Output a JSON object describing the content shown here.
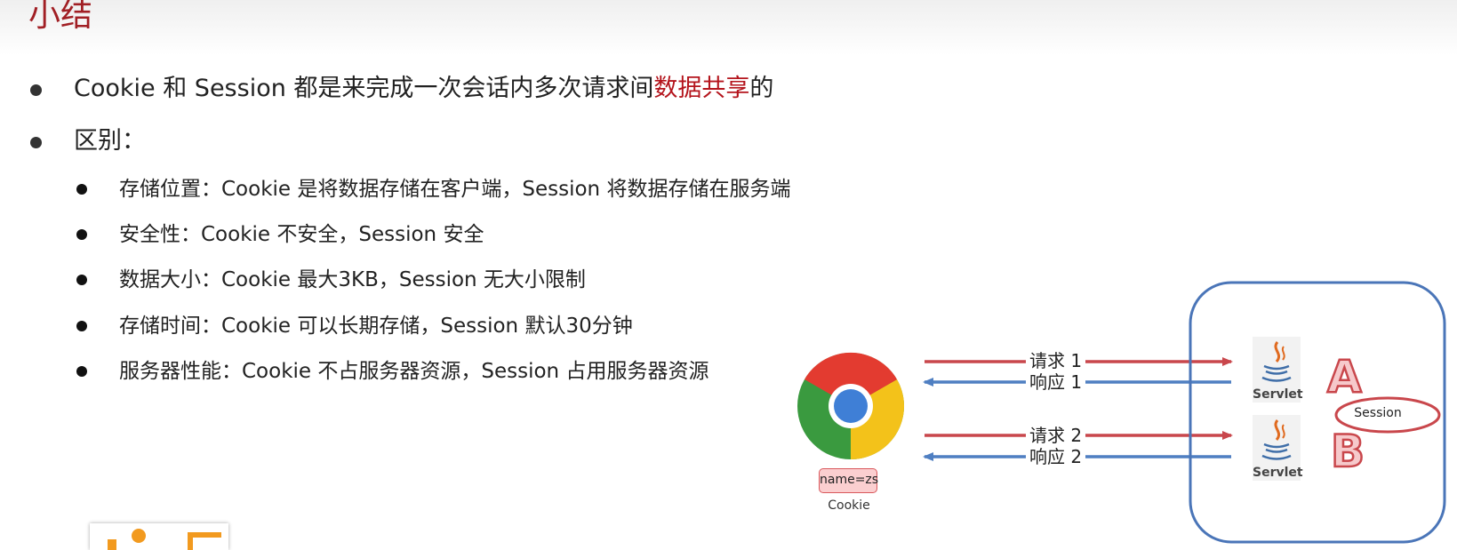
{
  "slide": {
    "title": "小结"
  },
  "bullets": [
    {
      "pre": "Cookie 和 Session 都是来完成一次会话内多次请求间",
      "highlight": "数据共享",
      "post": "的"
    },
    {
      "text": "区别："
    }
  ],
  "differences": [
    "存储位置：Cookie 是将数据存储在客户端，Session 将数据存储在服务端",
    "安全性：Cookie 不安全，Session 安全",
    "数据大小：Cookie 最大3KB，Session 无大小限制",
    "存储时间：Cookie 可以长期存储，Session 默认30分钟",
    "服务器性能：Cookie 不占服务器资源，Session 占用服务器资源"
  ],
  "diagram": {
    "browser_icon": "chrome-icon",
    "cookie_value": "name=zs",
    "cookie_label": "Cookie",
    "arrows": [
      {
        "label": "请求 1",
        "direction": "to-server",
        "color": "#c9474c"
      },
      {
        "label": "响应 1",
        "direction": "to-browser",
        "color": "#4f7fc2"
      },
      {
        "label": "请求 2",
        "direction": "to-server",
        "color": "#c9474c"
      },
      {
        "label": "响应 2",
        "direction": "to-browser",
        "color": "#4f7fc2"
      }
    ],
    "servers": [
      {
        "icon": "java-servlet-icon",
        "label": "Servlet",
        "letter": "A"
      },
      {
        "icon": "java-servlet-icon",
        "label": "Servlet",
        "letter": "B"
      }
    ],
    "session_label": "Session",
    "server_box_color": "#4a75b8",
    "session_ellipse_color": "#c9474c"
  },
  "colors": {
    "title": "#a11f24",
    "highlight": "#b4141c",
    "request_arrow": "#c9474c",
    "response_arrow": "#4f7fc2"
  }
}
